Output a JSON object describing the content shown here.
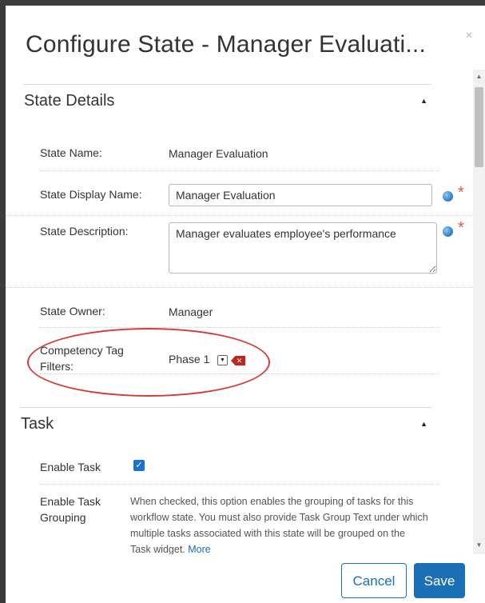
{
  "dialog": {
    "title": "Configure State - Manager Evaluati...",
    "close_icon": "close-icon"
  },
  "state_details": {
    "title": "State Details",
    "fields": {
      "state_name": {
        "label": "State Name:",
        "value": "Manager Evaluation"
      },
      "display_name": {
        "label": "State Display Name:",
        "value": "Manager Evaluation",
        "required_mark": "*"
      },
      "description": {
        "label": "State Description:",
        "value": "Manager evaluates employee's performance",
        "required_mark": "*"
      },
      "owner": {
        "label": "State Owner:",
        "value": "Manager"
      },
      "competency": {
        "label_line1": "Competency Tag",
        "label_line2": "Filters:",
        "value": "Phase 1"
      }
    }
  },
  "task": {
    "title": "Task",
    "enable_task": {
      "label": "Enable Task",
      "checked": true
    },
    "enable_grouping": {
      "label_line1": "Enable Task",
      "label_line2": "Grouping",
      "help_lines": [
        "When checked, this option enables the grouping of tasks for this",
        "workflow state. You must also provide Task Group Text under which",
        "multiple tasks associated with this state will be grouped on the",
        "Task widget."
      ],
      "more_link": "More"
    }
  },
  "footer": {
    "cancel_label": "Cancel",
    "save_label": "Save"
  },
  "colors": {
    "primary": "#1a6fb5",
    "required": "#d9534f",
    "highlight": "#d63a3a"
  }
}
